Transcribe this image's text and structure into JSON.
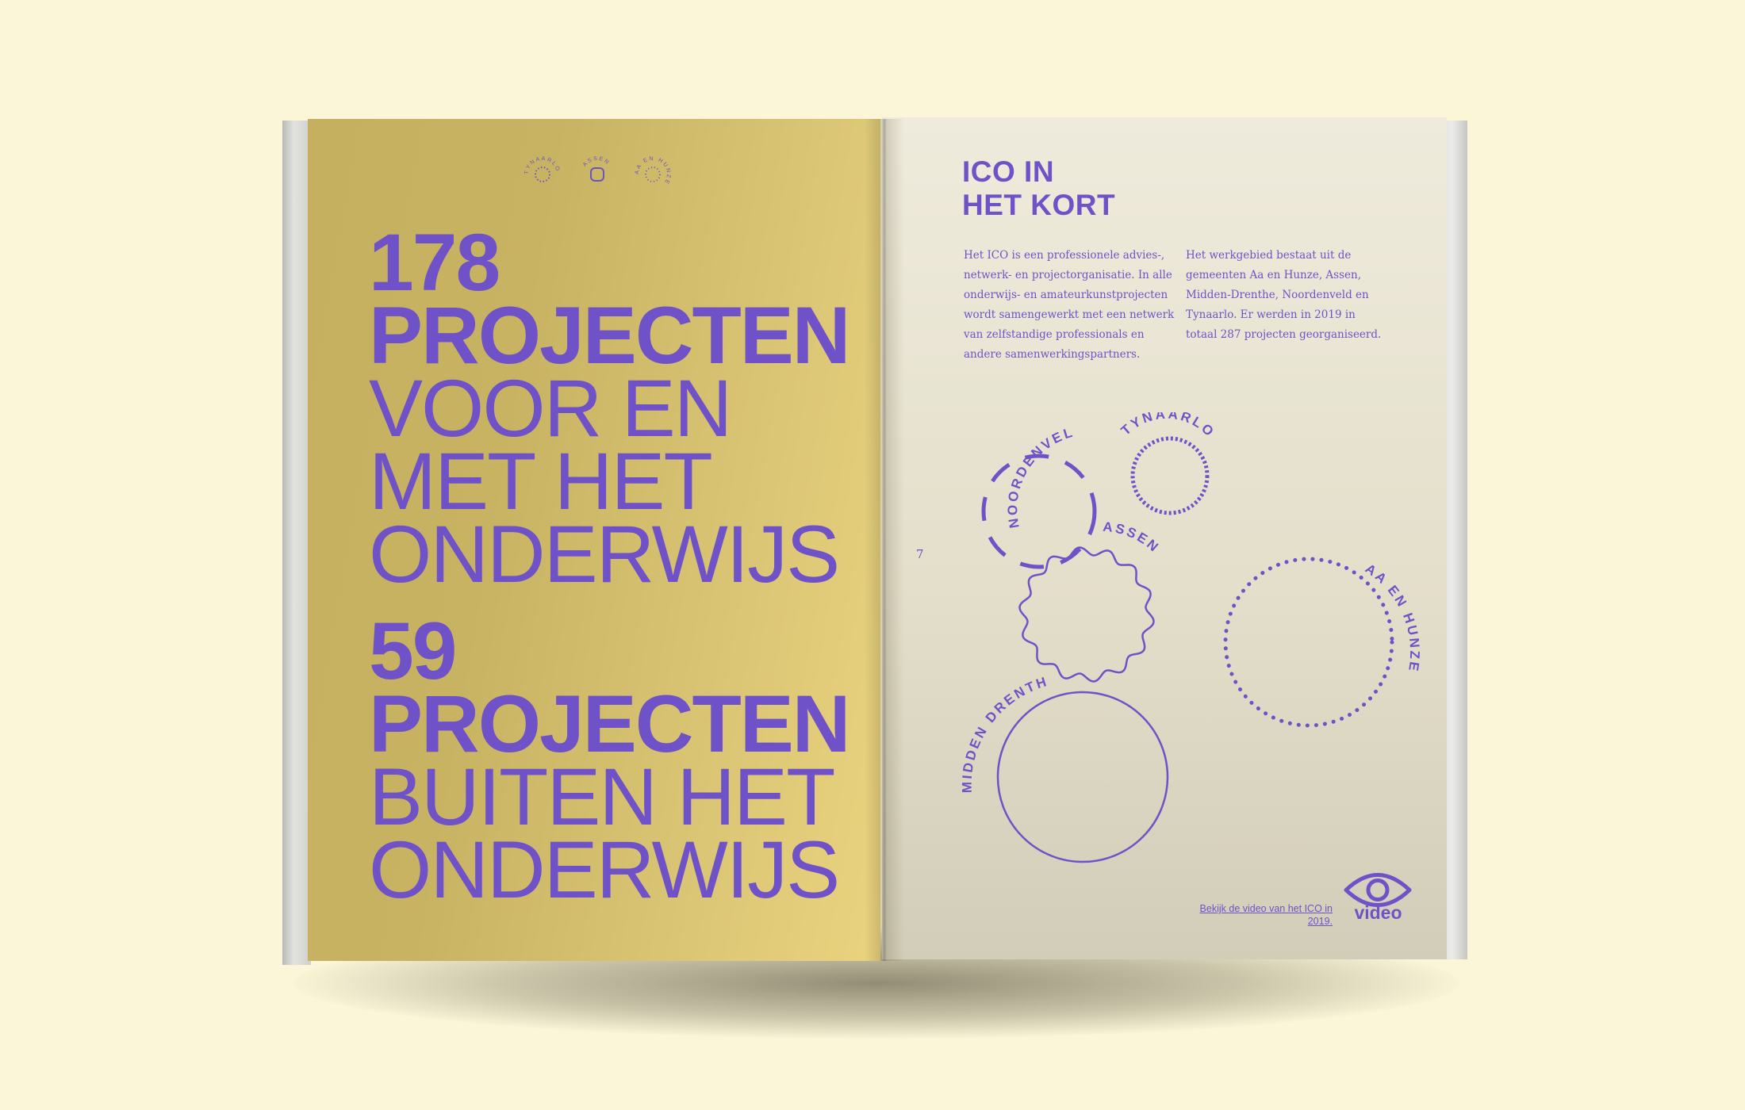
{
  "left_page": {
    "mini_logos": [
      "TYNAARLO",
      "ASSEN",
      "AA EN HUNZE"
    ],
    "headline_1": {
      "number": "178",
      "bold": "PROJECTEN",
      "lines": [
        "VOOR EN",
        "MET HET",
        "ONDERWIJS"
      ]
    },
    "headline_2": {
      "number": "59",
      "bold": "PROJECTEN",
      "lines": [
        "BUITEN HET",
        "ONDERWIJS"
      ]
    }
  },
  "right_page": {
    "title_line1": "ICO IN",
    "title_line2": "HET KORT",
    "col1": "Het ICO is een professionele advies-, netwerk- en projectorganisatie. In alle onderwijs- en amateurkunstprojecten wordt samengewerkt met een netwerk van zelfstandige professionals en andere samenwerkingspartners.",
    "col2": "Het werkgebied bestaat uit de gemeenten Aa en Hunze, Assen, Midden-Drenthe, Noordenveld en Tynaarlo. Er werden in 2019 in totaal 287 projecten georganiseerd.",
    "page_number": "7",
    "municipalities": {
      "noordenveld": "NOORDENVELD",
      "tynaarlo": "TYNAARLO",
      "assen": "ASSEN",
      "aa_en_hunze": "AA EN HUNZE",
      "midden_drenthe": "MIDDEN DRENTHE"
    },
    "video_link": "Bekijk de video van het ICO in 2019.",
    "video_label": "video"
  },
  "colors": {
    "accent": "#6f52c8",
    "left_page": "#d1bc6a",
    "right_page": "#e6e1cf",
    "background": "#fbf6d8"
  },
  "icons": [
    "eye-icon"
  ]
}
